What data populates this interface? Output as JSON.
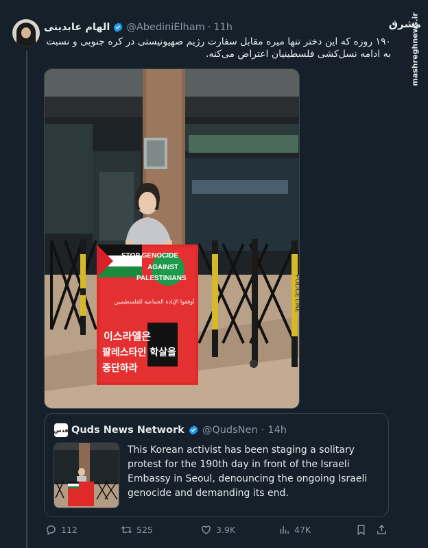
{
  "tweet": {
    "author_name": "الهام عابدینی",
    "author_handle": "@AbediniElham",
    "separator": "·",
    "time": "11h",
    "text": "۱۹۰ روزه که این دختر تنها میره مقابل سفارت رژیم صهیونیستی در کره جنوبی و نسبت به ادامه نسل‌کشی فلسطینیان اعتراض می‌کنه.",
    "photo": {
      "sign_english": "STOP GENOCIDE AGAINST PALESTINIANS",
      "sign_arabic": "أوقفوا الإبادة الجماعية للفلسطينيين",
      "sign_korean_1": "이스라엘은",
      "sign_korean_2": "팔레스타인 학살을",
      "sign_korean_3": "중단하라",
      "police_line": "POLICE LINE"
    }
  },
  "quote": {
    "author_name": "Quds News Network",
    "author_handle": "@QudsNen",
    "separator": "·",
    "time": "14h",
    "logo_text": "قدس",
    "text": "This Korean activist has been staging a solitary protest for the 190th day in front of the Israeli Embassy in Seoul, denouncing the ongoing Israeli genocide and demanding its end."
  },
  "actions": {
    "replies": "112",
    "reposts": "525",
    "likes": "3.9K",
    "views": "47K"
  },
  "watermark": {
    "logo": "مشرق",
    "site": "mashreghnews.ir"
  },
  "colors": {
    "background": "#15202b",
    "verified": "#1d9bf0",
    "muted": "#8b98a5",
    "sign_red": "#e02a2a"
  }
}
